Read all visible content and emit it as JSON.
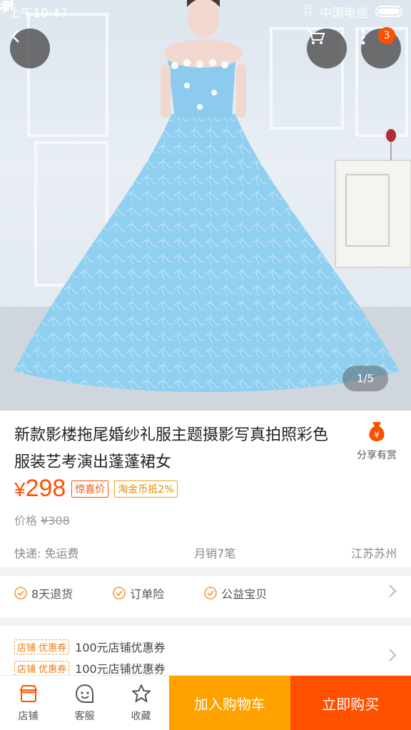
{
  "status_bar": {
    "time": "上午10:47",
    "network_top": "3G",
    "network_bottom": "1X",
    "carrier": "中国电信"
  },
  "header": {
    "cart_badge_count": "3"
  },
  "gallery": {
    "counter": "1/5"
  },
  "product": {
    "title": "新款影楼拖尾婚纱礼服主题摄影写真拍照彩色服装艺考演出蓬蓬裙女",
    "share_label": "分享有赏",
    "price_symbol": "¥",
    "price": "298",
    "tags": [
      "惊喜价",
      "淘金币抵2%"
    ],
    "original_price_label": "价格",
    "original_price": "¥308",
    "shipping": "快递: 免运费",
    "monthly_sales": "月销7笔",
    "location": "江苏苏州"
  },
  "services": [
    "8天退货",
    "订单险",
    "公益宝贝"
  ],
  "coupons": [
    {
      "tag": "店铺 优惠券",
      "text": "100元店铺优惠券"
    },
    {
      "tag": "店铺 优惠券",
      "text": "100元店铺优惠券"
    }
  ],
  "bottom_bar": {
    "shop": "店铺",
    "service": "客服",
    "favorite": "收藏",
    "add_to_cart": "加入购物车",
    "buy_now": "立即购买"
  },
  "colors": {
    "accent": "#ff5000",
    "cart_button": "#ffa200",
    "dress": "#8fcff0"
  }
}
